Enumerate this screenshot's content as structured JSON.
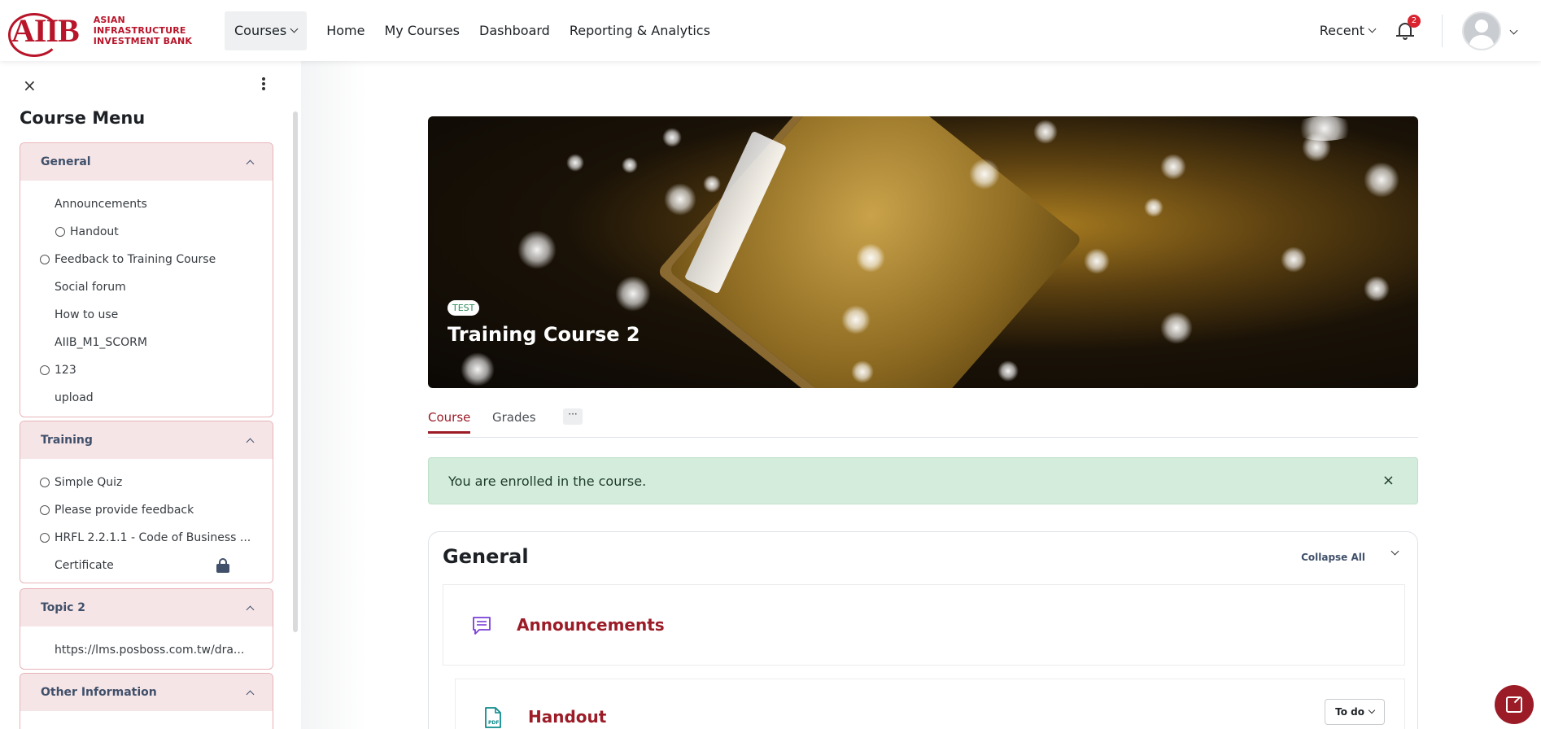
{
  "brand": {
    "line1": "ASIAN INFRASTRUCTURE",
    "line2": "INVESTMENT BANK",
    "mark": "AIIB"
  },
  "nav": {
    "courses": "Courses",
    "links": [
      "Home",
      "My Courses",
      "Dashboard",
      "Reporting & Analytics"
    ],
    "recent": "Recent",
    "notification_count": "2"
  },
  "drawer": {
    "close": "×",
    "title": "Course Menu",
    "sections": [
      {
        "title": "General",
        "items": [
          "Announcements",
          "Handout",
          "Feedback to Training Course",
          "Social forum",
          "How to use",
          "AIIB_M1_SCORM",
          "123",
          "upload"
        ]
      },
      {
        "title": "Training",
        "items": [
          "Simple Quiz",
          "Please provide feedback",
          "HRFL 2.2.1.1 - Code of Business ...",
          "Certificate"
        ]
      },
      {
        "title": "Topic 2",
        "items": [
          "https://lms.posboss.com.tw/dra..."
        ]
      },
      {
        "title": "Other Information",
        "items": []
      }
    ]
  },
  "hero": {
    "badge": "TEST",
    "title": "Training Course 2"
  },
  "tabs": {
    "course": "Course",
    "grades": "Grades",
    "more": "···"
  },
  "alert": {
    "message": "You are enrolled in the course.",
    "close": "×"
  },
  "general": {
    "title": "General",
    "collapse_all": "Collapse All",
    "activities": [
      {
        "title": "Announcements",
        "icon": "forum-icon"
      },
      {
        "title": "Handout",
        "icon": "pdf-icon",
        "status": "To do"
      }
    ]
  },
  "colors": {
    "brand": "#b8152a",
    "accent": "#9b1c27",
    "alert_bg": "#d4ecdc"
  }
}
